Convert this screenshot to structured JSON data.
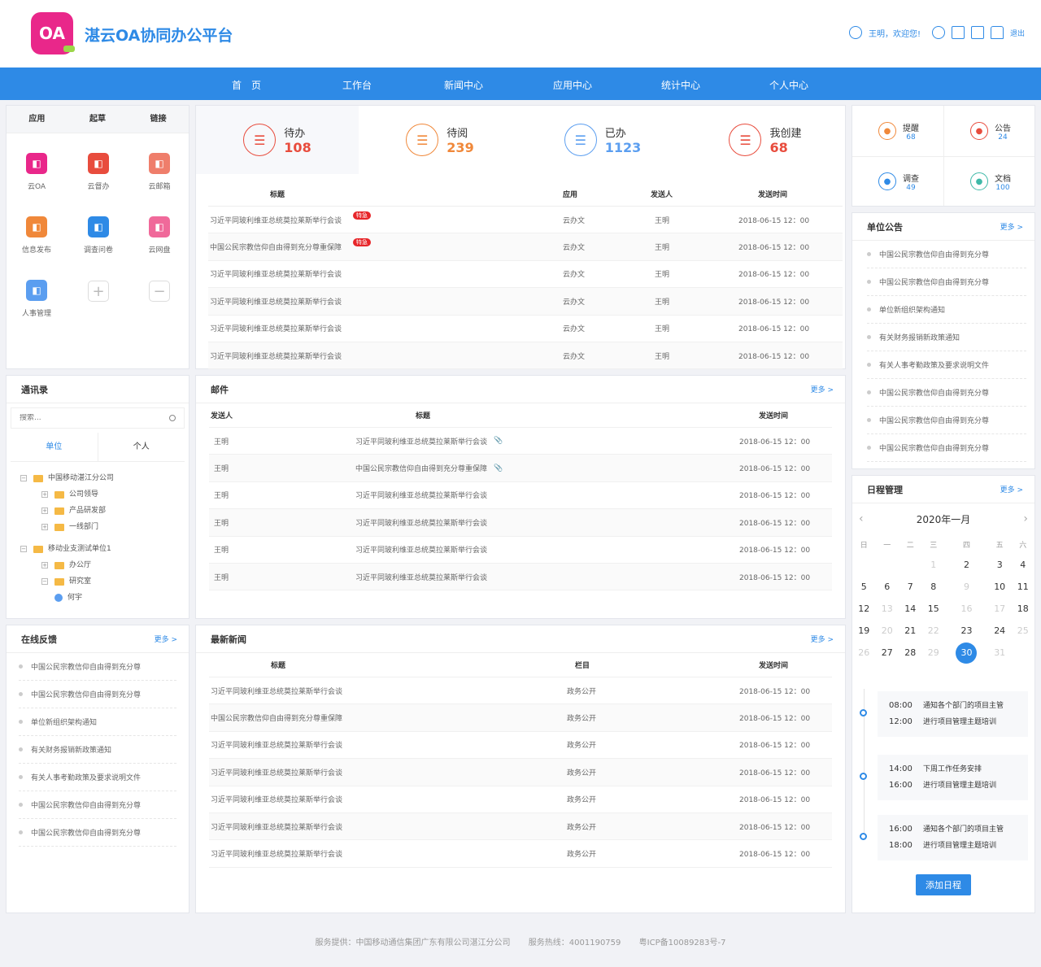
{
  "header": {
    "brand": "湛云OA协同办公平台",
    "logo": "OA",
    "welcome": "王明，欢迎您!",
    "logout": "退出"
  },
  "nav": [
    "首　页",
    "工作台",
    "新闻中心",
    "应用中心",
    "统计中心",
    "个人中心"
  ],
  "apps": {
    "tabs": [
      "应用",
      "起草",
      "链接"
    ],
    "items": [
      {
        "label": "云OA",
        "color": "#e9278a",
        "icon": "cloud-icon"
      },
      {
        "label": "云督办",
        "color": "#e84c3d",
        "icon": "shield-icon"
      },
      {
        "label": "云邮箱",
        "color": "#ef7e6b",
        "icon": "mail-icon"
      },
      {
        "label": "信息发布",
        "color": "#f0883a",
        "icon": "edit-icon"
      },
      {
        "label": "调查问卷",
        "color": "#2e8ae6",
        "icon": "survey-icon"
      },
      {
        "label": "云网盘",
        "color": "#f0699a",
        "icon": "cloud-upload-icon"
      },
      {
        "label": "人事管理",
        "color": "#5b9ef0",
        "icon": "user-card-icon"
      }
    ]
  },
  "stats": [
    {
      "label": "待办",
      "value": "108",
      "color": "#e84c3d"
    },
    {
      "label": "待阅",
      "value": "239",
      "color": "#f0883a"
    },
    {
      "label": "已办",
      "value": "1123",
      "color": "#5b9ef0"
    },
    {
      "label": "我创建",
      "value": "68",
      "color": "#e84c3d"
    }
  ],
  "todo": {
    "headers": [
      "标题",
      "应用",
      "发送人",
      "发送时间"
    ],
    "rows": [
      [
        "习近平同玻利维亚总统莫拉莱斯举行会谈",
        "云办文",
        "王明",
        "2018-06-15 12：00",
        "特急"
      ],
      [
        "中国公民宗教信仰自由得到充分尊重保障",
        "云办文",
        "王明",
        "2018-06-15 12：00",
        "特急"
      ],
      [
        "习近平同玻利维亚总统莫拉莱斯举行会谈",
        "云办文",
        "王明",
        "2018-06-15 12：00",
        ""
      ],
      [
        "习近平同玻利维亚总统莫拉莱斯举行会谈",
        "云办文",
        "王明",
        "2018-06-15 12：00",
        ""
      ],
      [
        "习近平同玻利维亚总统莫拉莱斯举行会谈",
        "云办文",
        "王明",
        "2018-06-15 12：00",
        ""
      ],
      [
        "习近平同玻利维亚总统莫拉莱斯举行会谈",
        "云办文",
        "王明",
        "2018-06-15 12：00",
        ""
      ]
    ]
  },
  "mail": {
    "title": "邮件",
    "more": "更多 >",
    "headers": [
      "发送人",
      "标题",
      "发送时间"
    ],
    "rows": [
      [
        "王明",
        "习近平同玻利维亚总统莫拉莱斯举行会谈",
        "2018-06-15 12：00",
        "📎"
      ],
      [
        "王明",
        "中国公民宗教信仰自由得到充分尊重保障",
        "2018-06-15 12：00",
        "📎"
      ],
      [
        "王明",
        "习近平同玻利维亚总统莫拉莱斯举行会谈",
        "2018-06-15 12：00",
        ""
      ],
      [
        "王明",
        "习近平同玻利维亚总统莫拉莱斯举行会谈",
        "2018-06-15 12：00",
        ""
      ],
      [
        "王明",
        "习近平同玻利维亚总统莫拉莱斯举行会谈",
        "2018-06-15 12：00",
        ""
      ],
      [
        "王明",
        "习近平同玻利维亚总统莫拉莱斯举行会谈",
        "2018-06-15 12：00",
        ""
      ]
    ]
  },
  "news": {
    "title": "最新新闻",
    "more": "更多 >",
    "headers": [
      "标题",
      "栏目",
      "发送时间"
    ],
    "rows": [
      [
        "习近平同玻利维亚总统莫拉莱斯举行会谈",
        "政务公开",
        "2018-06-15 12：00"
      ],
      [
        "中国公民宗教信仰自由得到充分尊重保障",
        "政务公开",
        "2018-06-15 12：00"
      ],
      [
        "习近平同玻利维亚总统莫拉莱斯举行会谈",
        "政务公开",
        "2018-06-15 12：00"
      ],
      [
        "习近平同玻利维亚总统莫拉莱斯举行会谈",
        "政务公开",
        "2018-06-15 12：00"
      ],
      [
        "习近平同玻利维亚总统莫拉莱斯举行会谈",
        "政务公开",
        "2018-06-15 12：00"
      ],
      [
        "习近平同玻利维亚总统莫拉莱斯举行会谈",
        "政务公开",
        "2018-06-15 12：00"
      ],
      [
        "习近平同玻利维亚总统莫拉莱斯举行会谈",
        "政务公开",
        "2018-06-15 12：00"
      ]
    ]
  },
  "contacts": {
    "title": "通讯录",
    "placeholder": "搜索...",
    "tabs": [
      "单位",
      "个人"
    ],
    "tree": [
      {
        "label": "中国移动湛江分公司",
        "level": 0,
        "type": "folder"
      },
      {
        "label": "公司领导",
        "level": 1,
        "type": "folder"
      },
      {
        "label": "产品研发部",
        "level": 1,
        "type": "folder"
      },
      {
        "label": "一线部门",
        "level": 1,
        "type": "folder"
      },
      {
        "label": "移动业支测试单位1",
        "level": 0,
        "type": "folder"
      },
      {
        "label": "办公厅",
        "level": 1,
        "type": "folder"
      },
      {
        "label": "研究室",
        "level": 1,
        "type": "folder"
      },
      {
        "label": "何宇",
        "level": 2,
        "type": "user"
      }
    ]
  },
  "feedback": {
    "title": "在线反馈",
    "more": "更多 >",
    "items": [
      "中国公民宗教信仰自由得到充分尊",
      "中国公民宗教信仰自由得到充分尊",
      "单位新组织架构通知",
      "有关财务报销新政策通知",
      "有关人事考勤政策及要求说明文件",
      "中国公民宗教信仰自由得到充分尊",
      "中国公民宗教信仰自由得到充分尊"
    ]
  },
  "quick": [
    {
      "label": "提醒",
      "value": "68",
      "color": "#f0883a",
      "icon": "bell-icon"
    },
    {
      "label": "公告",
      "value": "24",
      "color": "#e84c3d",
      "icon": "speaker-icon"
    },
    {
      "label": "调查",
      "value": "49",
      "color": "#2e8ae6",
      "icon": "survey-icon"
    },
    {
      "label": "文档",
      "value": "100",
      "color": "#3fb9a8",
      "icon": "doc-icon"
    }
  ],
  "notice": {
    "title": "单位公告",
    "more": "更多 >",
    "items": [
      "中国公民宗教信仰自由得到充分尊",
      "中国公民宗教信仰自由得到充分尊",
      "单位新组织架构通知",
      "有关财务报销新政策通知",
      "有关人事考勤政策及要求说明文件",
      "中国公民宗教信仰自由得到充分尊",
      "中国公民宗教信仰自由得到充分尊",
      "中国公民宗教信仰自由得到充分尊"
    ]
  },
  "schedule": {
    "title": "日程管理",
    "more": "更多 >",
    "month": "2020年一月",
    "weekdays": [
      "日",
      "一",
      "二",
      "三",
      "四",
      "五",
      "六"
    ],
    "weeks": [
      [
        "",
        "",
        "",
        "1",
        "2",
        "3",
        "4"
      ],
      [
        "5",
        "6",
        "7",
        "8",
        "9",
        "10",
        "11"
      ],
      [
        "12",
        "13",
        "14",
        "15",
        "16",
        "17",
        "18"
      ],
      [
        "19",
        "20",
        "21",
        "22",
        "23",
        "24",
        "25"
      ],
      [
        "26",
        "27",
        "28",
        "29",
        "30",
        "31",
        ""
      ]
    ],
    "today": "30",
    "events": [
      [
        [
          "08:00",
          "通知各个部门的项目主管"
        ],
        [
          "12:00",
          "进行项目管理主题培训"
        ]
      ],
      [
        [
          "14:00",
          "下周工作任务安排"
        ],
        [
          "16:00",
          "进行项目管理主题培训"
        ]
      ],
      [
        [
          "16:00",
          "通知各个部门的项目主管"
        ],
        [
          "18:00",
          "进行项目管理主题培训"
        ]
      ]
    ],
    "add": "添加日程"
  },
  "footer": {
    "provider": "服务提供：中国移动通信集团广东有限公司湛江分公司",
    "hotline": "服务热线：4001190759",
    "icp": "粤ICP备10089283号-7"
  }
}
